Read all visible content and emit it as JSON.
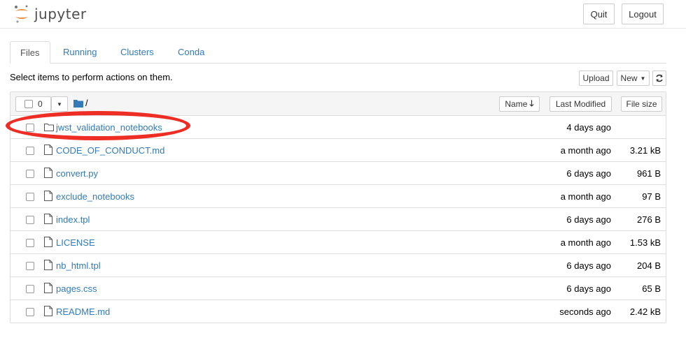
{
  "header": {
    "logo_text": "jupyter",
    "quit_label": "Quit",
    "logout_label": "Logout"
  },
  "tabs": [
    {
      "label": "Files",
      "active": true
    },
    {
      "label": "Running",
      "active": false
    },
    {
      "label": "Clusters",
      "active": false
    },
    {
      "label": "Conda",
      "active": false
    }
  ],
  "toolbar": {
    "instruction": "Select items to perform actions on them.",
    "upload_label": "Upload",
    "new_label": "New",
    "refresh_icon": "refresh-icon"
  },
  "list_header": {
    "selected_count": "0",
    "breadcrumb": "/",
    "name_label": "Name",
    "last_modified_label": "Last Modified",
    "file_size_label": "File size"
  },
  "files": [
    {
      "name": "jwst_validation_notebooks",
      "type": "folder",
      "modified": "4 days ago",
      "size": ""
    },
    {
      "name": "CODE_OF_CONDUCT.md",
      "type": "file",
      "modified": "a month ago",
      "size": "3.21 kB"
    },
    {
      "name": "convert.py",
      "type": "file",
      "modified": "6 days ago",
      "size": "961 B"
    },
    {
      "name": "exclude_notebooks",
      "type": "file",
      "modified": "a month ago",
      "size": "97 B"
    },
    {
      "name": "index.tpl",
      "type": "file",
      "modified": "6 days ago",
      "size": "276 B"
    },
    {
      "name": "LICENSE",
      "type": "file",
      "modified": "a month ago",
      "size": "1.53 kB"
    },
    {
      "name": "nb_html.tpl",
      "type": "file",
      "modified": "6 days ago",
      "size": "204 B"
    },
    {
      "name": "pages.css",
      "type": "file",
      "modified": "6 days ago",
      "size": "65 B"
    },
    {
      "name": "README.md",
      "type": "file",
      "modified": "seconds ago",
      "size": "2.42 kB"
    }
  ],
  "colors": {
    "link": "#337ab7",
    "highlight_oval": "#ee2d24",
    "logo_orange": "#f37726"
  }
}
